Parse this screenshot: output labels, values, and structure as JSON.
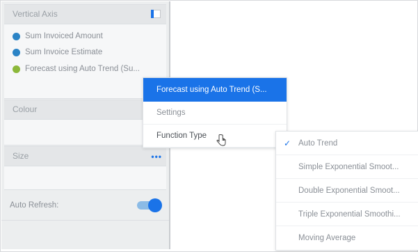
{
  "vertical_axis": {
    "title": "Vertical Axis",
    "measures": [
      {
        "label": "Sum Invoiced Amount",
        "color": "#2b84c6"
      },
      {
        "label": "Sum Invoice Estimate",
        "color": "#2b84c6"
      },
      {
        "label": "Forecast using Auto Trend (Su...",
        "color": "#8cb83a"
      }
    ]
  },
  "colour": {
    "title": "Colour"
  },
  "size": {
    "title": "Size",
    "more_icon": "•••"
  },
  "auto_refresh": {
    "label": "Auto Refresh:",
    "enabled": true
  },
  "context_menu": {
    "items": [
      {
        "label": "Forecast using Auto Trend (S...",
        "state": "active"
      },
      {
        "label": "Settings",
        "state": "normal"
      },
      {
        "label": "Function Type",
        "state": "hover"
      }
    ]
  },
  "function_type_menu": {
    "items": [
      {
        "label": "Auto Trend",
        "checked": true
      },
      {
        "label": "Simple Exponential Smoot...",
        "checked": false
      },
      {
        "label": "Double Exponential Smoot...",
        "checked": false
      },
      {
        "label": "Triple Exponential Smoothi...",
        "checked": false
      },
      {
        "label": "Moving Average",
        "checked": false
      }
    ],
    "check_glyph": "✓"
  },
  "colors": {
    "accent": "#1a73e8",
    "panel_bg": "#eceeef"
  }
}
